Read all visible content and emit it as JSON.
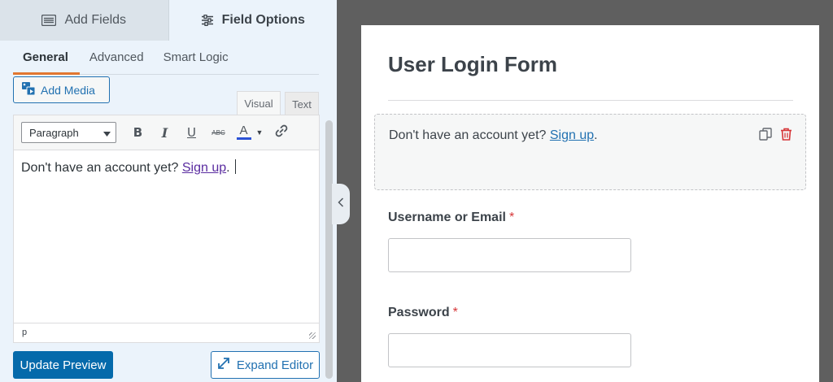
{
  "top_tabs": {
    "add_fields": "Add Fields",
    "field_options": "Field Options"
  },
  "sub_tabs": [
    "General",
    "Advanced",
    "Smart Logic"
  ],
  "editor": {
    "add_media": "Add Media",
    "mode_visual": "Visual",
    "mode_text": "Text",
    "format_select": "Paragraph",
    "toolbar": {
      "bold": "B",
      "italic": "I",
      "underline": "U",
      "strikethrough": "ABC",
      "text_color": "A"
    },
    "content_text": "Don't have an account yet? ",
    "content_link": "Sign up",
    "content_after": ".",
    "status_path": "p"
  },
  "buttons": {
    "update_preview": "Update Preview",
    "expand_editor": "Expand Editor"
  },
  "preview": {
    "title": "User Login Form",
    "html_text": "Don't have an account yet? ",
    "html_link": "Sign up",
    "html_after": ".",
    "fields": [
      {
        "label": "Username or Email",
        "required": "*"
      },
      {
        "label": "Password",
        "required": "*"
      }
    ]
  },
  "colors": {
    "accent": "#2271b1",
    "tab_underline": "#e27730",
    "required": "#d63638",
    "delete_icon": "#d63638"
  }
}
